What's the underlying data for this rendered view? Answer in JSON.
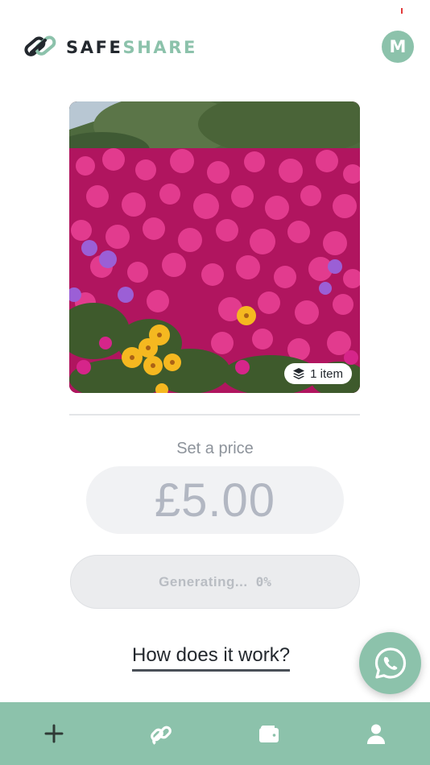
{
  "app": {
    "brand_part1": "SAFE",
    "brand_part2": "SHARE",
    "avatar_initial": "M"
  },
  "colors": {
    "accent": "#8cc2ab",
    "text_dark": "#23282e",
    "muted": "#8d939b"
  },
  "media": {
    "item_count_label": "1 item",
    "badge_icon": "layers-icon"
  },
  "pricing": {
    "label": "Set a price",
    "value": "£5.00"
  },
  "generate": {
    "label": "Generating...",
    "progress_label": "0%",
    "progress": 0
  },
  "help": {
    "link_label": "How does it work?"
  },
  "fab": {
    "icon": "whatsapp-icon"
  },
  "nav": {
    "items": [
      {
        "icon": "plus-icon"
      },
      {
        "icon": "link-icon"
      },
      {
        "icon": "wallet-icon"
      },
      {
        "icon": "user-icon"
      }
    ]
  }
}
